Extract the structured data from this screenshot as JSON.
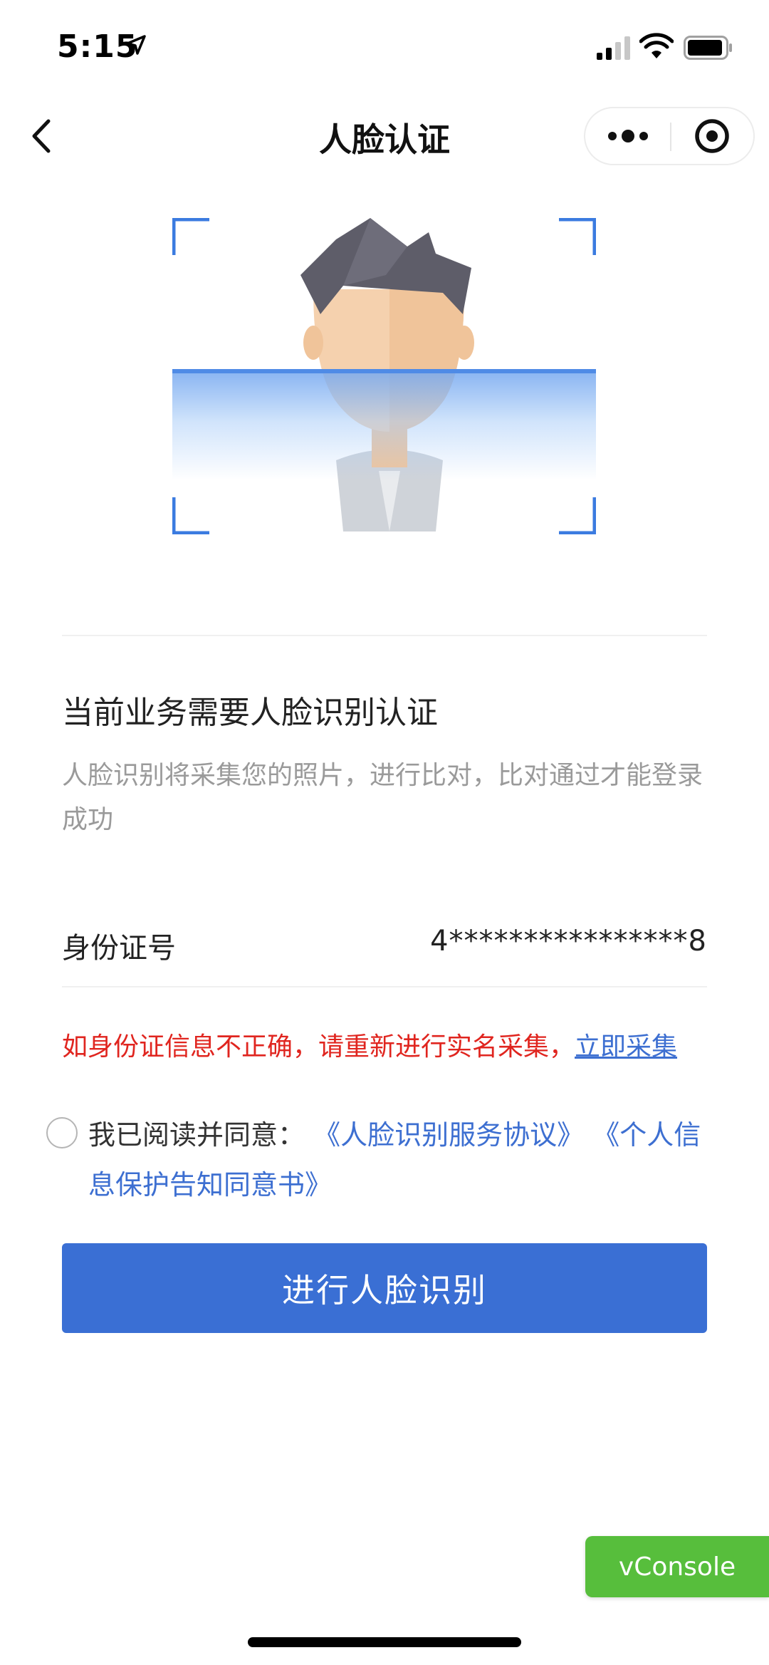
{
  "status_bar": {
    "time": "5:15"
  },
  "nav": {
    "title": "人脸认证"
  },
  "content": {
    "heading": "当前业务需要人脸识别认证",
    "description": "人脸识别将采集您的照片，进行比对，比对通过才能登录成功",
    "id_label": "身份证号",
    "id_value": "4****************8",
    "warning_text": "如身份证信息不正确，请重新进行实名采集，",
    "warning_link": "立即采集",
    "agree_prefix": "我已阅读并同意：",
    "agreement_1": "《人脸识别服务协议》",
    "agreement_2": "《个人信息保护告知同意书》",
    "agreement_checked": false,
    "primary_button": "进行人脸识别"
  },
  "vconsole": {
    "label": "vConsole"
  },
  "colors": {
    "accent": "#3a6fd4",
    "link": "#3d6fd1",
    "warning": "#e0251f",
    "vconsole": "#57be3c",
    "frame": "#3b7be0"
  },
  "icons": {
    "back": "chevron-left-icon",
    "more": "more-dots-icon",
    "close": "target-close-icon",
    "location": "location-arrow-icon",
    "signal": "signal-icon",
    "wifi": "wifi-icon",
    "battery": "battery-icon"
  }
}
